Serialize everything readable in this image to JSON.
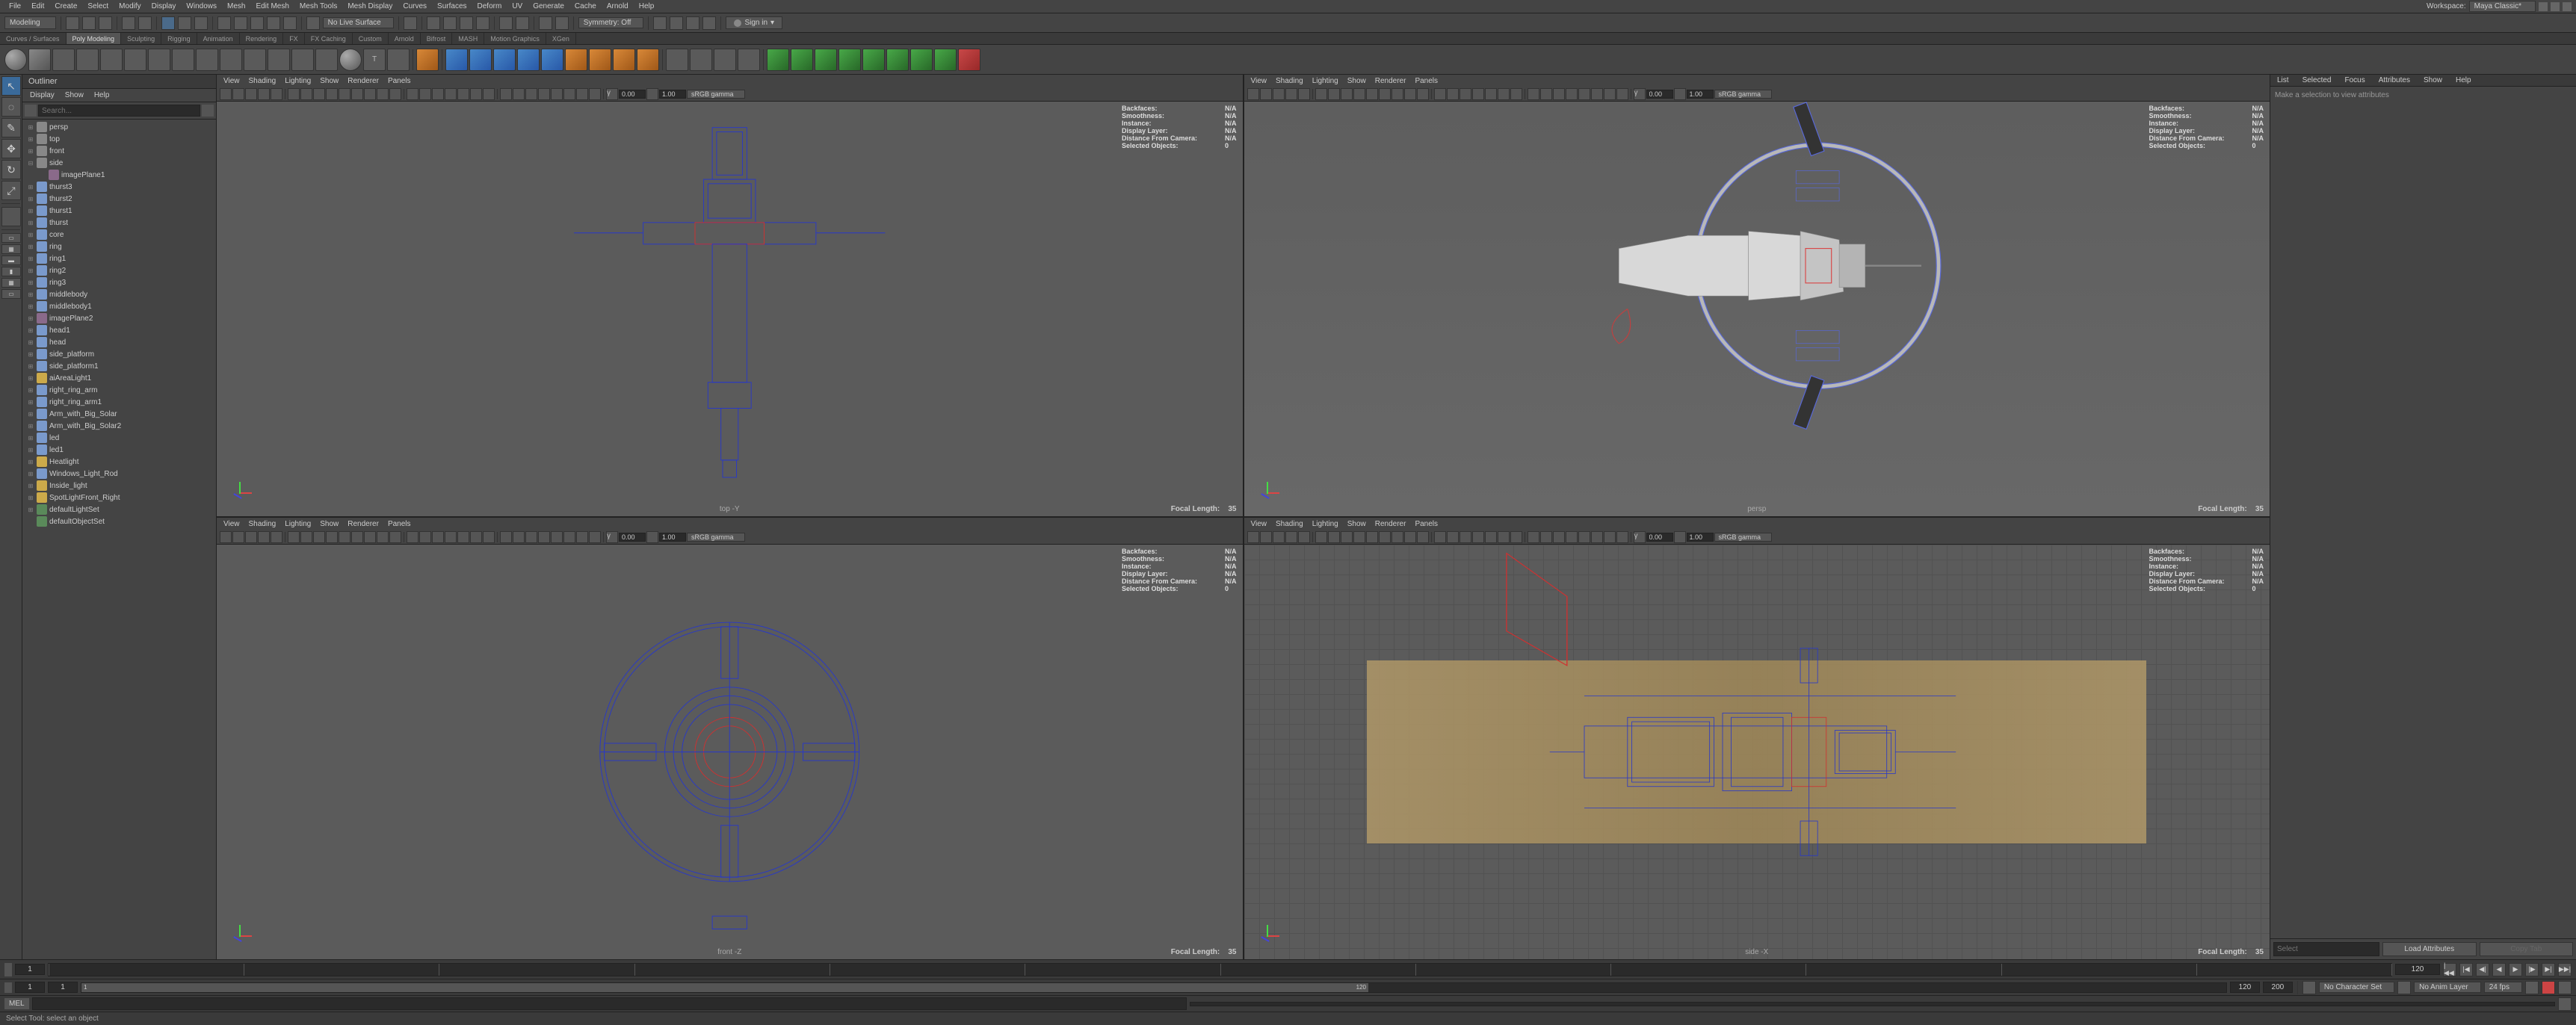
{
  "menubar": {
    "items": [
      "File",
      "Edit",
      "Create",
      "Select",
      "Modify",
      "Display",
      "Windows",
      "Mesh",
      "Edit Mesh",
      "Mesh Tools",
      "Mesh Display",
      "Curves",
      "Surfaces",
      "Deform",
      "UV",
      "Generate",
      "Cache",
      "Arnold",
      "Help"
    ],
    "workspace_label": "Workspace:",
    "workspace_value": "Maya Classic*"
  },
  "statusline": {
    "mode": "Modeling",
    "no_live": "No Live Surface",
    "symmetry": "Symmetry: Off",
    "signin": "Sign in"
  },
  "shelftabs": [
    "Curves / Surfaces",
    "Poly Modeling",
    "Sculpting",
    "Rigging",
    "Animation",
    "Rendering",
    "FX",
    "FX Caching",
    "Custom",
    "Arnold",
    "Bifrost",
    "MASH",
    "Motion Graphics",
    "XGen"
  ],
  "shelf_active_idx": 1,
  "outliner": {
    "title": "Outliner",
    "menu": [
      "Display",
      "Show",
      "Help"
    ],
    "search_placeholder": "Search...",
    "items": [
      {
        "l": 0,
        "icon": "cam",
        "toggle": "+",
        "label": "persp"
      },
      {
        "l": 0,
        "icon": "cam",
        "toggle": "+",
        "label": "top"
      },
      {
        "l": 0,
        "icon": "cam",
        "toggle": "+",
        "label": "front"
      },
      {
        "l": 0,
        "icon": "cam",
        "toggle": "-",
        "label": "side"
      },
      {
        "l": 1,
        "icon": "img",
        "toggle": "",
        "label": "imagePlane1"
      },
      {
        "l": 0,
        "icon": "mesh",
        "toggle": "+",
        "label": "thurst3"
      },
      {
        "l": 0,
        "icon": "mesh",
        "toggle": "+",
        "label": "thurst2"
      },
      {
        "l": 0,
        "icon": "mesh",
        "toggle": "+",
        "label": "thurst1"
      },
      {
        "l": 0,
        "icon": "mesh",
        "toggle": "+",
        "label": "thurst"
      },
      {
        "l": 0,
        "icon": "mesh",
        "toggle": "+",
        "label": "core"
      },
      {
        "l": 0,
        "icon": "mesh",
        "toggle": "+",
        "label": "ring"
      },
      {
        "l": 0,
        "icon": "mesh",
        "toggle": "+",
        "label": "ring1"
      },
      {
        "l": 0,
        "icon": "mesh",
        "toggle": "+",
        "label": "ring2"
      },
      {
        "l": 0,
        "icon": "mesh",
        "toggle": "+",
        "label": "ring3"
      },
      {
        "l": 0,
        "icon": "mesh",
        "toggle": "+",
        "label": "middlebody"
      },
      {
        "l": 0,
        "icon": "mesh",
        "toggle": "+",
        "label": "middlebody1"
      },
      {
        "l": 0,
        "icon": "img",
        "toggle": "+",
        "label": "imagePlane2"
      },
      {
        "l": 0,
        "icon": "mesh",
        "toggle": "+",
        "label": "head1"
      },
      {
        "l": 0,
        "icon": "mesh",
        "toggle": "+",
        "label": "head"
      },
      {
        "l": 0,
        "icon": "mesh",
        "toggle": "+",
        "label": "side_platform"
      },
      {
        "l": 0,
        "icon": "mesh",
        "toggle": "+",
        "label": "side_platform1"
      },
      {
        "l": 0,
        "icon": "light",
        "toggle": "+",
        "label": "aiAreaLight1"
      },
      {
        "l": 0,
        "icon": "mesh",
        "toggle": "+",
        "label": "right_ring_arm"
      },
      {
        "l": 0,
        "icon": "mesh",
        "toggle": "+",
        "label": "right_ring_arm1"
      },
      {
        "l": 0,
        "icon": "mesh",
        "toggle": "+",
        "label": "Arm_with_Big_Solar"
      },
      {
        "l": 0,
        "icon": "mesh",
        "toggle": "+",
        "label": "Arm_with_Big_Solar2"
      },
      {
        "l": 0,
        "icon": "mesh",
        "toggle": "+",
        "label": "led"
      },
      {
        "l": 0,
        "icon": "mesh",
        "toggle": "+",
        "label": "led1"
      },
      {
        "l": 0,
        "icon": "light",
        "toggle": "+",
        "label": "Heatlight"
      },
      {
        "l": 0,
        "icon": "mesh",
        "toggle": "+",
        "label": "Windows_Light_Rod"
      },
      {
        "l": 0,
        "icon": "light",
        "toggle": "+",
        "label": "Inside_light"
      },
      {
        "l": 0,
        "icon": "light",
        "toggle": "+",
        "label": "SpotLightFront_Right"
      },
      {
        "l": 0,
        "icon": "set",
        "toggle": "+",
        "label": "defaultLightSet"
      },
      {
        "l": 0,
        "icon": "set",
        "toggle": "",
        "label": "defaultObjectSet"
      }
    ]
  },
  "viewport_menu": [
    "View",
    "Shading",
    "Lighting",
    "Show",
    "Renderer",
    "Panels"
  ],
  "vp_toolbar": {
    "gamma_icon": "γ",
    "num1": "0.00",
    "num2": "1.00",
    "colorspace": "sRGB gamma"
  },
  "hud": {
    "rows": [
      {
        "label": "Backfaces:",
        "val": "N/A"
      },
      {
        "label": "Smoothness:",
        "val": "N/A"
      },
      {
        "label": "Instance:",
        "val": "N/A"
      },
      {
        "label": "Display Layer:",
        "val": "N/A"
      },
      {
        "label": "Distance From Camera:",
        "val": "N/A"
      },
      {
        "label": "Selected Objects:",
        "val": "0"
      }
    ]
  },
  "viewports": {
    "tl": {
      "label": "top -Y",
      "focal": "Focal Length:",
      "focal_val": "35"
    },
    "tr": {
      "label": "persp",
      "focal": "Focal Length:",
      "focal_val": "35"
    },
    "bl": {
      "label": "front -Z",
      "focal": "Focal Length:",
      "focal_val": "35"
    },
    "br": {
      "label": "side -X",
      "focal": "Focal Length:",
      "focal_val": "35"
    }
  },
  "channelbox": {
    "tabs": [
      "List",
      "Selected",
      "Focus",
      "Attributes",
      "Show",
      "Help"
    ],
    "placeholder": "Make a selection to view attributes",
    "select_placeholder": "Select",
    "load_btn": "Load Attributes",
    "copy_btn": "Copy Tab"
  },
  "timeslider": {
    "start": "1",
    "end": "120",
    "current": "1"
  },
  "rangeslider": {
    "start": "1",
    "end": "200",
    "inner_start": "1",
    "inner_end": "120",
    "range_start_field": "120",
    "range_end_field": "200",
    "charset": "No Character Set",
    "anim_layer": "No Anim Layer",
    "fps": "24 fps"
  },
  "cmdline": {
    "lang": "MEL"
  },
  "helpline": {
    "text": "Select Tool: select an object"
  }
}
